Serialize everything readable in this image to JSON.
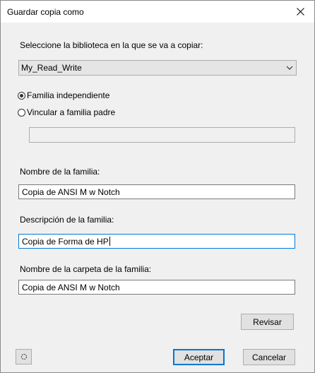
{
  "window": {
    "title": "Guardar copia como"
  },
  "library": {
    "label": "Seleccione la biblioteca en la que se va a copiar:",
    "selected": "My_Read_Write"
  },
  "options": {
    "independent_label": "Familia independiente",
    "link_parent_label": "Vincular a familia padre",
    "selected": "independent",
    "parent_value": ""
  },
  "family_name": {
    "label": "Nombre de la familia:",
    "value": "Copia de ANSI M w Notch"
  },
  "family_description": {
    "label": "Descripción de la familia:",
    "value": "Copia de Forma de HP"
  },
  "folder_name": {
    "label": "Nombre de la carpeta de la familia:",
    "value": "Copia de ANSI M w Notch"
  },
  "buttons": {
    "review": "Revisar",
    "accept": "Aceptar",
    "cancel": "Cancelar"
  },
  "icons": {
    "close": "close-icon",
    "help": "help-icon",
    "dropdown": "chevron-down-icon"
  },
  "colors": {
    "focus": "#0078d7",
    "background": "#f0f0f0"
  }
}
